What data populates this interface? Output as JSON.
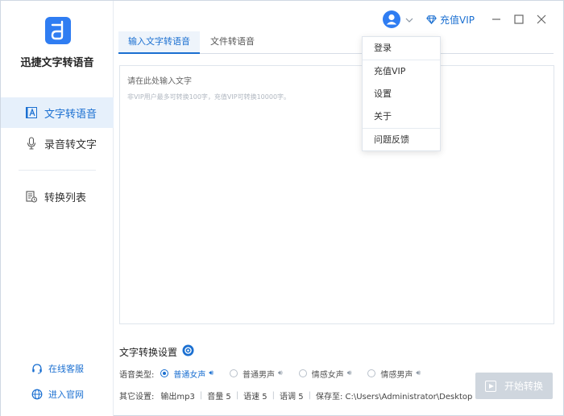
{
  "app": {
    "name": "迅捷文字转语音"
  },
  "sidebar": {
    "items": [
      {
        "label": "文字转语音",
        "icon": "text-a-icon",
        "active": true
      },
      {
        "label": "录音转文字",
        "icon": "microphone-icon",
        "active": false
      },
      {
        "label": "转换列表",
        "icon": "list-doc-icon",
        "active": false
      }
    ],
    "links": [
      {
        "label": "在线客服",
        "icon": "headset-icon"
      },
      {
        "label": "进入官网",
        "icon": "globe-icon"
      }
    ]
  },
  "header": {
    "vip_label": "充值VIP"
  },
  "tabs": [
    {
      "label": "输入文字转语音",
      "active": true
    },
    {
      "label": "文件转语音",
      "active": false
    }
  ],
  "editor": {
    "placeholder": "请在此处输入文字",
    "hint": "非VIP用户最多可转换100字，充值VIP可转换10000字。"
  },
  "menu": {
    "items": [
      "登录",
      "充值VIP",
      "设置",
      "关于",
      "问题反馈"
    ]
  },
  "settings": {
    "title": "文字转换设置",
    "voice_label": "语音类型:",
    "voices": [
      {
        "label": "普通女声",
        "selected": true
      },
      {
        "label": "普通男声",
        "selected": false
      },
      {
        "label": "情感女声",
        "selected": false
      },
      {
        "label": "情感男声",
        "selected": false
      }
    ],
    "other_label": "其它设置:",
    "output": "输出mp3",
    "volume": "音量 5",
    "speed": "语速 5",
    "pitch": "语调 5",
    "save_to": "保存至: C:\\Users\\Administrator\\Desktop"
  },
  "start_button": "开始转换",
  "colors": {
    "accent": "#1a6fd1",
    "brand": "#2f7df2",
    "active_bg": "#e6f0fb",
    "disabled_btn": "#cfd6de"
  }
}
